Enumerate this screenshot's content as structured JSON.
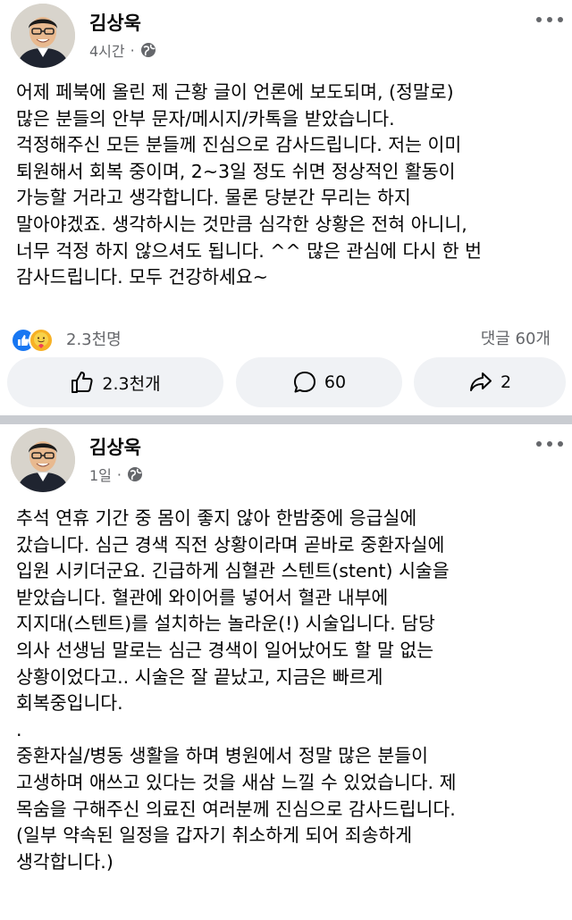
{
  "post1": {
    "author": "김상욱",
    "time": "4시간",
    "dot": "·",
    "text_lines": [
      "어제 페북에 올린 제 근황 글이 언론에 보도되며, (정말로)",
      "많은 분들의 안부 문자/메시지/카톡을 받았습니다.",
      "걱정해주신 모든 분들께 진심으로 감사드립니다. 저는 이미",
      "퇴원해서 회복 중이며, 2~3일 정도 쉬면 정상적인 활동이",
      "가능할 거라고 생각합니다. 물론 당분간 무리는 하지",
      "말아야겠죠. 생각하시는 것만큼 심각한 상황은 전혀 아니니,",
      "너무 걱정 하지 않으셔도 됩니다. ^^ 많은 관심에 다시 한 번",
      "감사드립니다. 모두 건강하세요~"
    ],
    "reactions_count": "2.3천명",
    "comments_count": "댓글 60개",
    "actions": {
      "like_label": "2.3천개",
      "comment_label": "60",
      "share_label": "2"
    }
  },
  "post2": {
    "author": "김상욱",
    "time": "1일",
    "dot": "·",
    "text_lines": [
      "추석 연휴 기간 중 몸이 좋지 않아 한밤중에 응급실에",
      "갔습니다. 심근 경색 직전 상황이라며 곧바로 중환자실에",
      "입원 시키더군요. 긴급하게 심혈관 스텐트(stent) 시술을",
      "받았습니다. 혈관에 와이어를 넣어서 혈관 내부에",
      "지지대(스텐트)를 설치하는 놀라운(!) 시술입니다. 담당",
      "의사 선생님 말로는 심근 경색이 일어났어도 할 말 없는",
      "상황이었다고.. 시술은 잘 끝났고, 지금은 빠르게",
      "회복중입니다.",
      ".",
      "중환자실/병동 생활을 하며 병원에서 정말 많은 분들이",
      "고생하며 애쓰고 있다는 것을 새삼 느낄 수 있었습니다. 제",
      "목숨을 구해주신 의료진 여러분께 진심으로 감사드립니다.",
      "(일부 약속된 일정을 갑자기 취소하게 되어 죄송하게",
      "생각합니다.)"
    ]
  },
  "colors": {
    "text": "#050505",
    "secondary": "#65676b",
    "button_bg": "#f0f2f5",
    "like_blue": "#1877f2",
    "care_yellow": "#f7b125",
    "divider": "#c9ccd1"
  },
  "icons": {
    "more": "more-horizontal-icon",
    "privacy": "globe-icon",
    "like": "thumbs-up-icon",
    "comment": "comment-bubble-icon",
    "share": "share-arrow-icon"
  }
}
